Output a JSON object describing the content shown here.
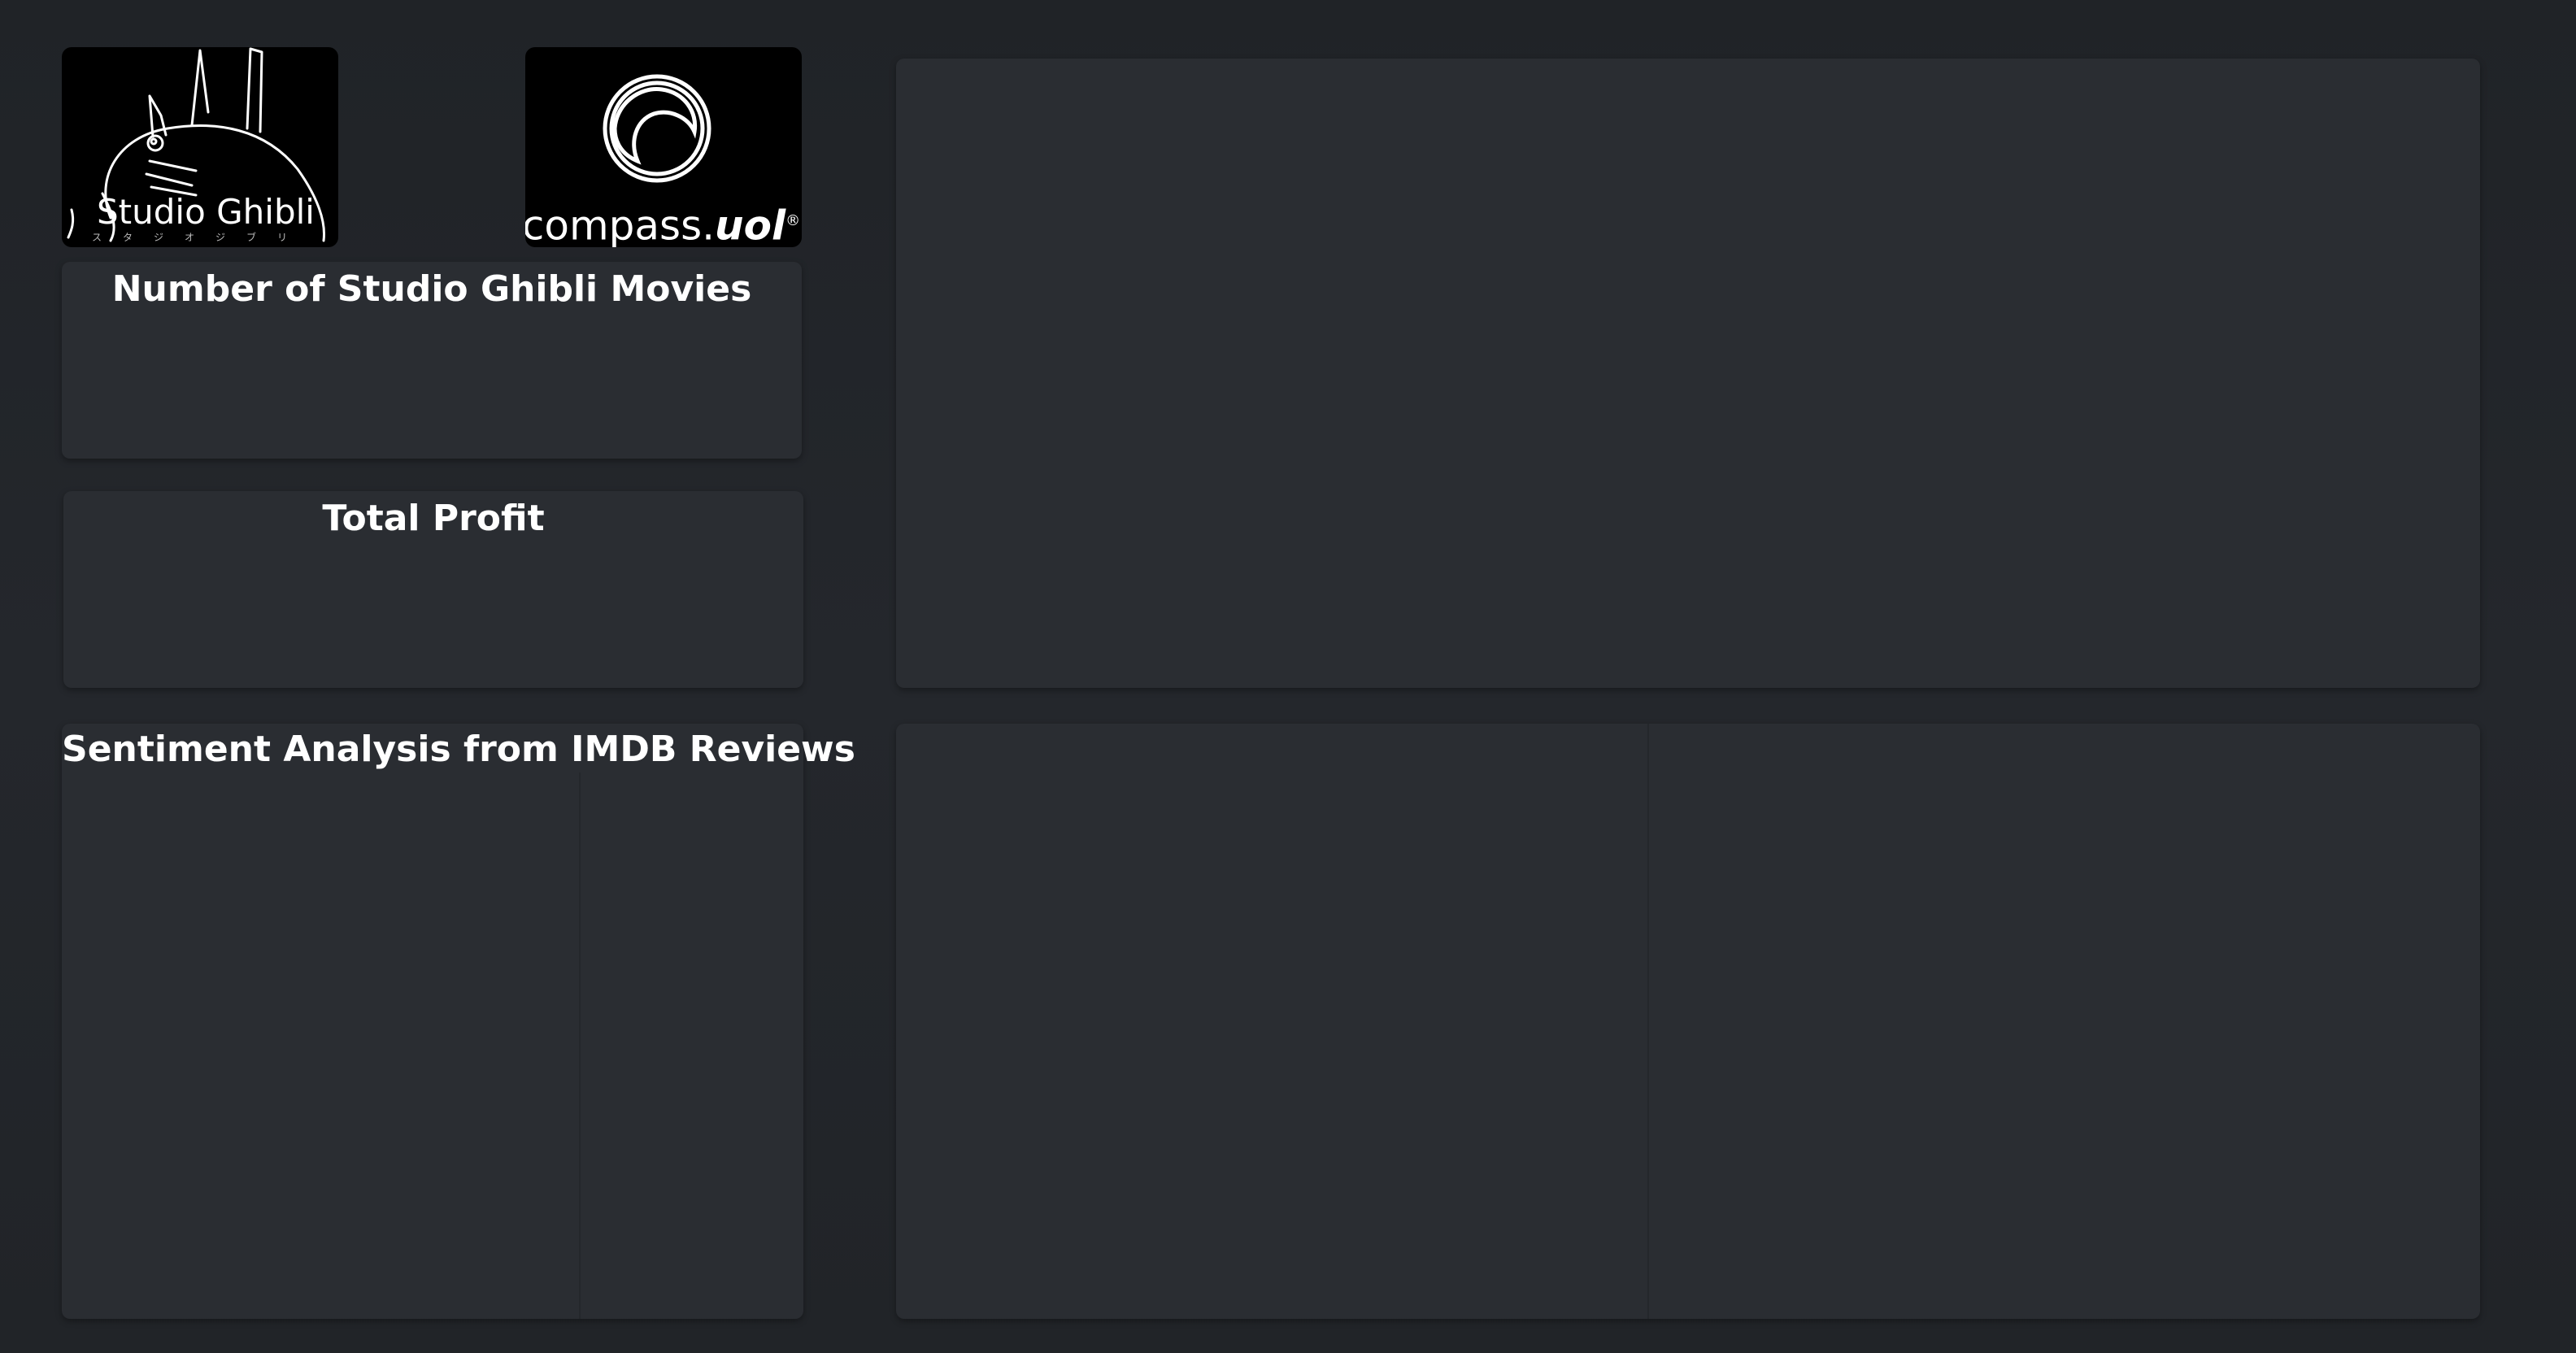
{
  "logos": {
    "ghibli": {
      "name": "Studio Ghibli",
      "subtitle": "スタジオジブリ"
    },
    "compass": {
      "name_prefix": "compass.",
      "name_suffix": "uol",
      "registered_mark": "®"
    }
  },
  "panels": {
    "movie_count": {
      "title": "Number of Studio Ghibli Movies"
    },
    "total_profit": {
      "title": "Total Profit"
    },
    "sentiment": {
      "title": "Sentiment Analysis from IMDB Reviews"
    }
  },
  "colors": {
    "background": "#212428",
    "panel": "#2a2d32",
    "title_text": "#ffffff",
    "logo_background": "#000000"
  }
}
